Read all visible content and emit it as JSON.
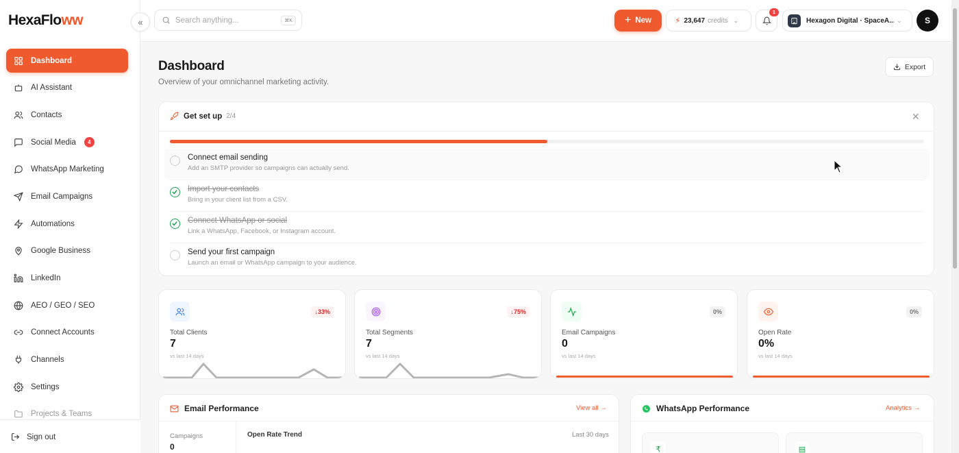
{
  "app": {
    "logo_text_main": "HexaFlo",
    "logo_text_accent": "ww"
  },
  "sidebar": {
    "items": [
      {
        "label": "Dashboard",
        "icon": "grid-icon",
        "active": true
      },
      {
        "label": "AI Assistant",
        "icon": "bot-icon"
      },
      {
        "label": "Contacts",
        "icon": "users-icon"
      },
      {
        "label": "Social Media",
        "icon": "message-square-icon",
        "badge": "4"
      },
      {
        "label": "WhatsApp Marketing",
        "icon": "message-circle-icon"
      },
      {
        "label": "Email Campaigns",
        "icon": "send-icon"
      },
      {
        "label": "Automations",
        "icon": "zap-icon"
      },
      {
        "label": "Google Business",
        "icon": "map-pin-icon"
      },
      {
        "label": "LinkedIn",
        "icon": "linkedin-icon"
      },
      {
        "label": "AEO / GEO / SEO",
        "icon": "globe-icon"
      },
      {
        "label": "Connect Accounts",
        "icon": "link-icon"
      },
      {
        "label": "Channels",
        "icon": "plug-icon"
      },
      {
        "label": "Settings",
        "icon": "gear-icon"
      },
      {
        "label": "Projects & Teams",
        "icon": "folder-icon",
        "faded": true
      }
    ],
    "signout_label": "Sign out",
    "collapse_glyph": "«"
  },
  "topbar": {
    "search_placeholder": "Search anything...",
    "search_shortcut": "⌘K",
    "new_label": "New",
    "credits_value": "23,647",
    "credits_label": "credits",
    "notification_count": "1",
    "workspace_name": "Hexagon Digital · SpaceA...",
    "user_initial": "S"
  },
  "header": {
    "title": "Dashboard",
    "subtitle": "Overview of your omnichannel marketing activity.",
    "export_label": "Export"
  },
  "setup": {
    "title": "Get set up",
    "count": "2/4",
    "progress": 0.5,
    "tasks": [
      {
        "title": "Connect email sending",
        "desc": "Add an SMTP provider so campaigns can actually send.",
        "done": false
      },
      {
        "title": "Import your contacts",
        "desc": "Bring in your client list from a CSV.",
        "done": true
      },
      {
        "title": "Connect WhatsApp or social",
        "desc": "Link a WhatsApp, Facebook, or Instagram account.",
        "done": true
      },
      {
        "title": "Send your first campaign",
        "desc": "Launch an email or WhatsApp campaign to your audience.",
        "done": false
      }
    ]
  },
  "stats": [
    {
      "label": "Total Clients",
      "value": "7",
      "change": "↓33%",
      "sub": "vs last 14 days",
      "icon": "users-icon",
      "color": "#3b82f6"
    },
    {
      "label": "Total Segments",
      "value": "7",
      "change": "↓75%",
      "sub": "vs last 14 days",
      "icon": "target-icon",
      "color": "#a855f7"
    },
    {
      "label": "Email Campaigns",
      "value": "0",
      "change": "0%",
      "sub": "vs last 14 days",
      "icon": "activity-icon",
      "color": "#16a34a"
    },
    {
      "label": "Open Rate",
      "value": "0%",
      "change": "0%",
      "sub": "vs last 14 days",
      "icon": "eye-icon",
      "color": "#ef5a2f"
    }
  ],
  "email_perf": {
    "title": "Email Performance",
    "link": "View all →",
    "campaigns_label": "Campaigns",
    "campaigns_value": "0",
    "trend_label": "Open Rate Trend",
    "trend_range": "Last 30 days"
  },
  "whatsapp_perf": {
    "title": "WhatsApp Performance",
    "link": "Analytics →",
    "tile1_icon": "₹",
    "tile2_icon": "▤"
  },
  "colors": {
    "accent": "#ef5a2f",
    "success": "#16a34a",
    "danger": "#dc2626"
  }
}
